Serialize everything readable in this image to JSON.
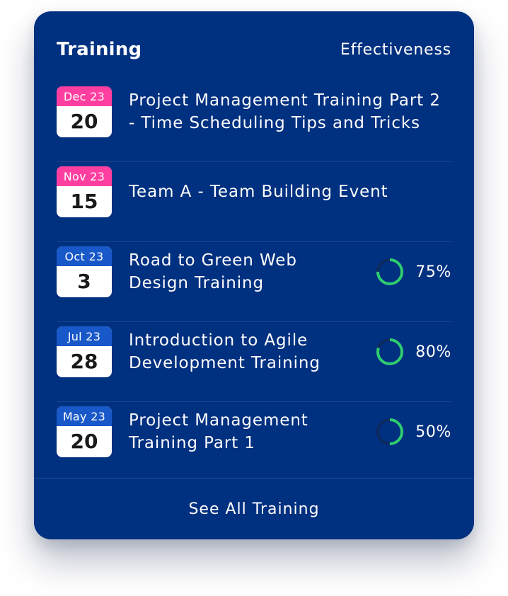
{
  "card": {
    "title": "Training",
    "column_label": "Effectiveness",
    "footer_link": "See All Training"
  },
  "colors": {
    "card_background": "#003080",
    "month_pink": "#ff3fa0",
    "month_blue": "#1858c8",
    "progress_green": "#2ecc71",
    "progress_track": "#0d2a5e"
  },
  "trainings": [
    {
      "month": "Dec 23",
      "day": "20",
      "name": "Project Management Training Part 2 - Time Scheduling Tips and Tricks",
      "month_style": "pink",
      "effectiveness": null
    },
    {
      "month": "Nov 23",
      "day": "15",
      "name": "Team A - Team Building Event",
      "month_style": "pink",
      "effectiveness": null
    },
    {
      "month": "Oct 23",
      "day": "3",
      "name": "Road to Green Web Design Training",
      "month_style": "blue",
      "effectiveness": 75,
      "effectiveness_label": "75%"
    },
    {
      "month": "Jul 23",
      "day": "28",
      "name": "Introduction to Agile Development Training",
      "month_style": "blue",
      "effectiveness": 80,
      "effectiveness_label": "80%"
    },
    {
      "month": "May 23",
      "day": "20",
      "name": "Project Management Training Part 1",
      "month_style": "blue",
      "effectiveness": 50,
      "effectiveness_label": "50%"
    }
  ]
}
